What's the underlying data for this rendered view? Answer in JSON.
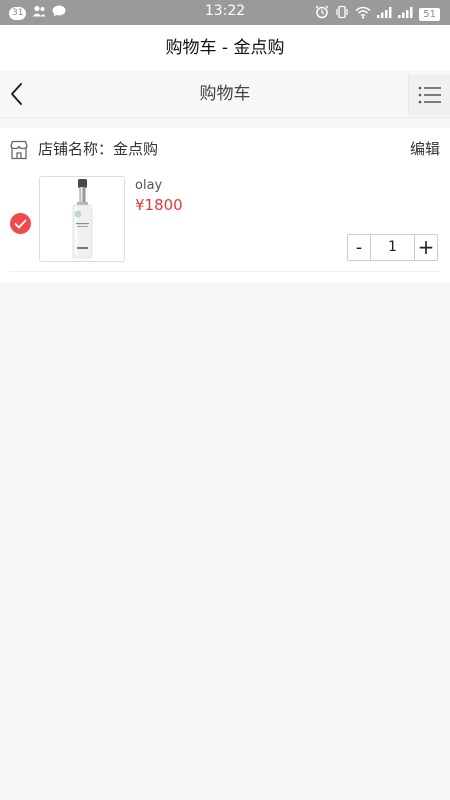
{
  "status_bar": {
    "notification_count": "31",
    "time": "13:22",
    "battery": "51"
  },
  "app_title": "购物车 - 金点购",
  "navbar": {
    "title": "购物车"
  },
  "shop": {
    "name_label": "店铺名称：金点购",
    "edit_label": "编辑"
  },
  "item": {
    "name": "olay",
    "price": "¥1800",
    "quantity": "1",
    "minus_label": "-",
    "plus_label": "+",
    "selected": true
  },
  "colors": {
    "accent": "#f04a4a",
    "price": "#e4393c",
    "status_bar": "#9a9a9a"
  }
}
